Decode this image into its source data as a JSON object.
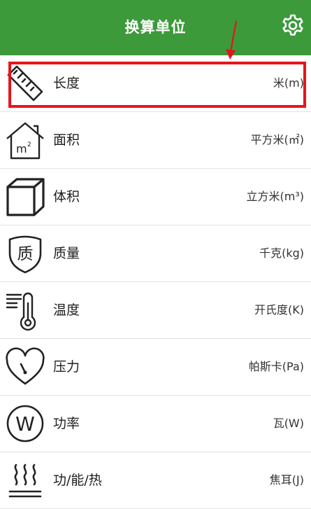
{
  "header": {
    "title": "换算单位",
    "settings_icon": "gear-icon",
    "background": "#3c9a3b"
  },
  "annotation": {
    "color": "#e8141d"
  },
  "list": [
    {
      "label": "长度",
      "unit": "米(m)",
      "icon": "ruler-icon"
    },
    {
      "label": "面积",
      "unit": "平方米(㎡)",
      "icon": "area-house-icon"
    },
    {
      "label": "体积",
      "unit": "立方米(m³)",
      "icon": "cube-icon"
    },
    {
      "label": "质量",
      "unit": "千克(kg)",
      "icon": "mass-shield-icon",
      "icon_text": "质"
    },
    {
      "label": "温度",
      "unit": "开氏度(K)",
      "icon": "thermometer-icon"
    },
    {
      "label": "压力",
      "unit": "帕斯卡(Pa)",
      "icon": "pressure-heart-gauge-icon"
    },
    {
      "label": "功率",
      "unit": "瓦(W)",
      "icon": "power-w-icon",
      "icon_text": "W"
    },
    {
      "label": "功/能/热",
      "unit": "焦耳(J)",
      "icon": "heat-waves-icon"
    }
  ]
}
